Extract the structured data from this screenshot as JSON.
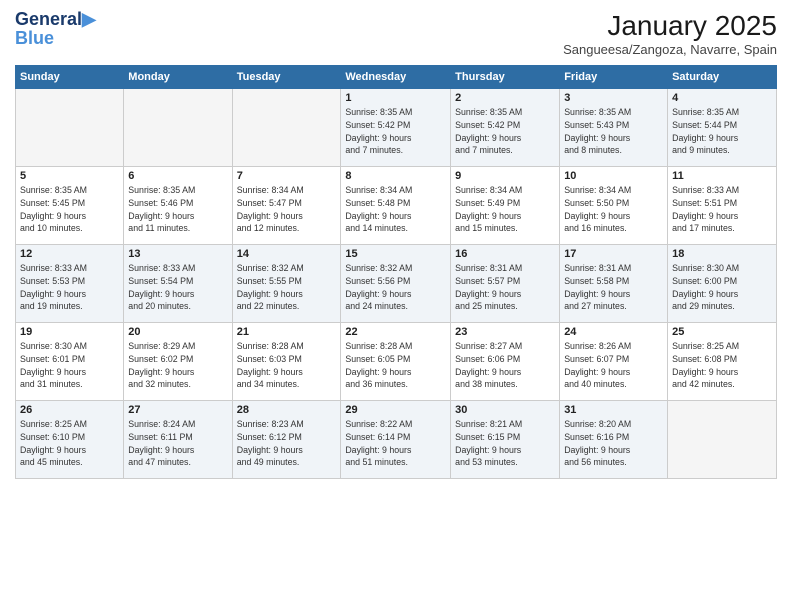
{
  "logo": {
    "line1": "General",
    "line2": "Blue"
  },
  "header": {
    "month": "January 2025",
    "location": "Sangueesa/Zangoza, Navarre, Spain"
  },
  "days_of_week": [
    "Sunday",
    "Monday",
    "Tuesday",
    "Wednesday",
    "Thursday",
    "Friday",
    "Saturday"
  ],
  "weeks": [
    [
      {
        "day": "",
        "info": ""
      },
      {
        "day": "",
        "info": ""
      },
      {
        "day": "",
        "info": ""
      },
      {
        "day": "1",
        "info": "Sunrise: 8:35 AM\nSunset: 5:42 PM\nDaylight: 9 hours\nand 7 minutes."
      },
      {
        "day": "2",
        "info": "Sunrise: 8:35 AM\nSunset: 5:42 PM\nDaylight: 9 hours\nand 7 minutes."
      },
      {
        "day": "3",
        "info": "Sunrise: 8:35 AM\nSunset: 5:43 PM\nDaylight: 9 hours\nand 8 minutes."
      },
      {
        "day": "4",
        "info": "Sunrise: 8:35 AM\nSunset: 5:44 PM\nDaylight: 9 hours\nand 9 minutes."
      }
    ],
    [
      {
        "day": "5",
        "info": "Sunrise: 8:35 AM\nSunset: 5:45 PM\nDaylight: 9 hours\nand 10 minutes."
      },
      {
        "day": "6",
        "info": "Sunrise: 8:35 AM\nSunset: 5:46 PM\nDaylight: 9 hours\nand 11 minutes."
      },
      {
        "day": "7",
        "info": "Sunrise: 8:34 AM\nSunset: 5:47 PM\nDaylight: 9 hours\nand 12 minutes."
      },
      {
        "day": "8",
        "info": "Sunrise: 8:34 AM\nSunset: 5:48 PM\nDaylight: 9 hours\nand 14 minutes."
      },
      {
        "day": "9",
        "info": "Sunrise: 8:34 AM\nSunset: 5:49 PM\nDaylight: 9 hours\nand 15 minutes."
      },
      {
        "day": "10",
        "info": "Sunrise: 8:34 AM\nSunset: 5:50 PM\nDaylight: 9 hours\nand 16 minutes."
      },
      {
        "day": "11",
        "info": "Sunrise: 8:33 AM\nSunset: 5:51 PM\nDaylight: 9 hours\nand 17 minutes."
      }
    ],
    [
      {
        "day": "12",
        "info": "Sunrise: 8:33 AM\nSunset: 5:53 PM\nDaylight: 9 hours\nand 19 minutes."
      },
      {
        "day": "13",
        "info": "Sunrise: 8:33 AM\nSunset: 5:54 PM\nDaylight: 9 hours\nand 20 minutes."
      },
      {
        "day": "14",
        "info": "Sunrise: 8:32 AM\nSunset: 5:55 PM\nDaylight: 9 hours\nand 22 minutes."
      },
      {
        "day": "15",
        "info": "Sunrise: 8:32 AM\nSunset: 5:56 PM\nDaylight: 9 hours\nand 24 minutes."
      },
      {
        "day": "16",
        "info": "Sunrise: 8:31 AM\nSunset: 5:57 PM\nDaylight: 9 hours\nand 25 minutes."
      },
      {
        "day": "17",
        "info": "Sunrise: 8:31 AM\nSunset: 5:58 PM\nDaylight: 9 hours\nand 27 minutes."
      },
      {
        "day": "18",
        "info": "Sunrise: 8:30 AM\nSunset: 6:00 PM\nDaylight: 9 hours\nand 29 minutes."
      }
    ],
    [
      {
        "day": "19",
        "info": "Sunrise: 8:30 AM\nSunset: 6:01 PM\nDaylight: 9 hours\nand 31 minutes."
      },
      {
        "day": "20",
        "info": "Sunrise: 8:29 AM\nSunset: 6:02 PM\nDaylight: 9 hours\nand 32 minutes."
      },
      {
        "day": "21",
        "info": "Sunrise: 8:28 AM\nSunset: 6:03 PM\nDaylight: 9 hours\nand 34 minutes."
      },
      {
        "day": "22",
        "info": "Sunrise: 8:28 AM\nSunset: 6:05 PM\nDaylight: 9 hours\nand 36 minutes."
      },
      {
        "day": "23",
        "info": "Sunrise: 8:27 AM\nSunset: 6:06 PM\nDaylight: 9 hours\nand 38 minutes."
      },
      {
        "day": "24",
        "info": "Sunrise: 8:26 AM\nSunset: 6:07 PM\nDaylight: 9 hours\nand 40 minutes."
      },
      {
        "day": "25",
        "info": "Sunrise: 8:25 AM\nSunset: 6:08 PM\nDaylight: 9 hours\nand 42 minutes."
      }
    ],
    [
      {
        "day": "26",
        "info": "Sunrise: 8:25 AM\nSunset: 6:10 PM\nDaylight: 9 hours\nand 45 minutes."
      },
      {
        "day": "27",
        "info": "Sunrise: 8:24 AM\nSunset: 6:11 PM\nDaylight: 9 hours\nand 47 minutes."
      },
      {
        "day": "28",
        "info": "Sunrise: 8:23 AM\nSunset: 6:12 PM\nDaylight: 9 hours\nand 49 minutes."
      },
      {
        "day": "29",
        "info": "Sunrise: 8:22 AM\nSunset: 6:14 PM\nDaylight: 9 hours\nand 51 minutes."
      },
      {
        "day": "30",
        "info": "Sunrise: 8:21 AM\nSunset: 6:15 PM\nDaylight: 9 hours\nand 53 minutes."
      },
      {
        "day": "31",
        "info": "Sunrise: 8:20 AM\nSunset: 6:16 PM\nDaylight: 9 hours\nand 56 minutes."
      },
      {
        "day": "",
        "info": ""
      }
    ]
  ]
}
